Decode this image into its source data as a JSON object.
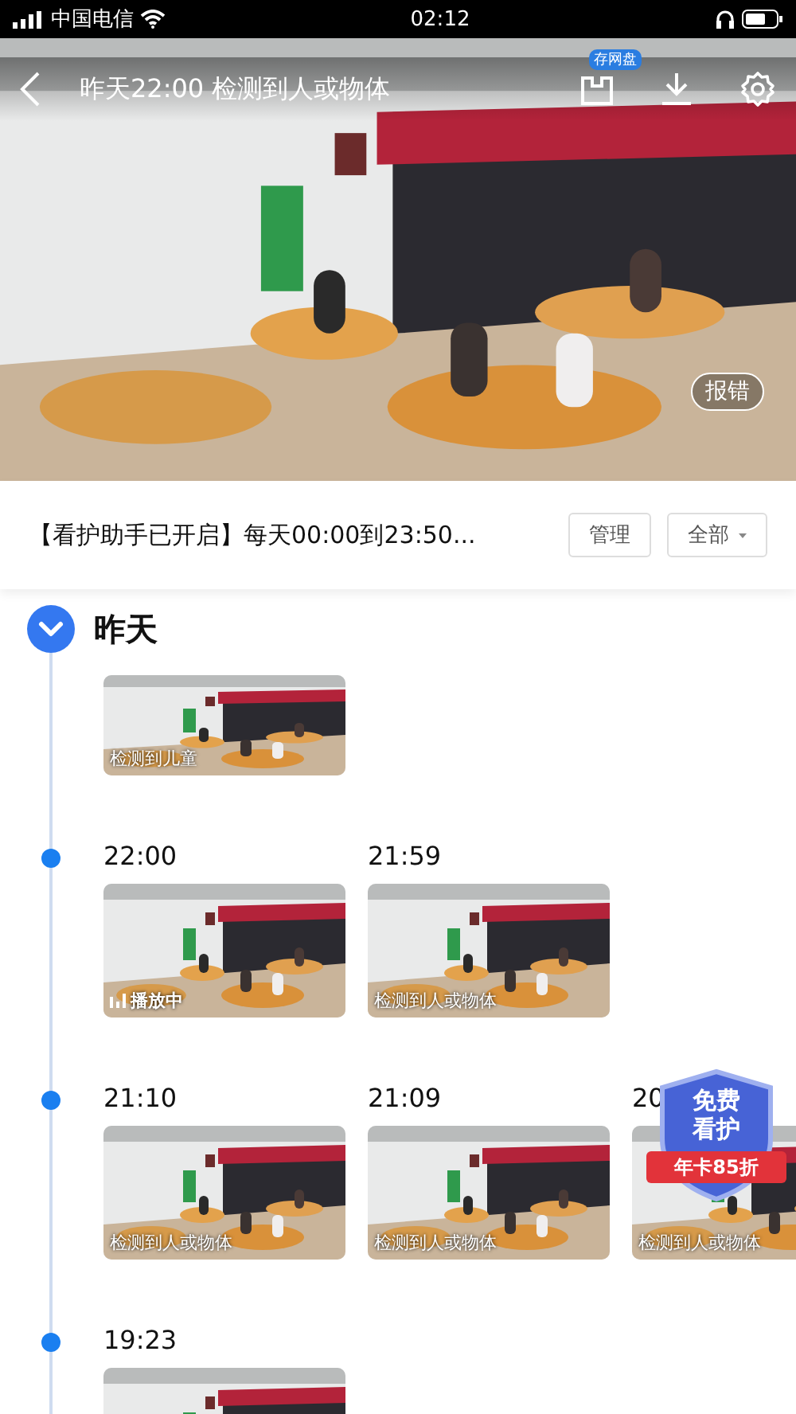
{
  "status_bar": {
    "carrier": "中国电信",
    "time": "02:12"
  },
  "header": {
    "title": "昨天22:00 检测到人或物体",
    "save_badge": "存网盘",
    "report_button": "报错"
  },
  "assistant_bar": {
    "text": "【看护助手已开启】每天00:00到23:50...",
    "manage_button": "管理",
    "filter": "全部"
  },
  "timeline": {
    "day": "昨天",
    "expanded": true,
    "groups": [
      {
        "clips": [
          {
            "label": "检测到儿童",
            "playing": false
          }
        ]
      },
      {
        "clips": [
          {
            "time": "22:00",
            "label": "播放中",
            "playing": true
          },
          {
            "time": "21:59",
            "label": "检测到人或物体",
            "playing": false
          }
        ]
      },
      {
        "clips": [
          {
            "time": "21:10",
            "label": "检测到人或物体",
            "playing": false
          },
          {
            "time": "21:09",
            "label": "检测到人或物体",
            "playing": false
          },
          {
            "time": "20",
            "label": "检测到人或物体",
            "playing": false
          }
        ]
      },
      {
        "clips": [
          {
            "time": "19:23"
          }
        ]
      }
    ]
  },
  "promo_badge": {
    "line_1": "免费",
    "line_2": "看护",
    "ribbon": "年卡85折"
  }
}
